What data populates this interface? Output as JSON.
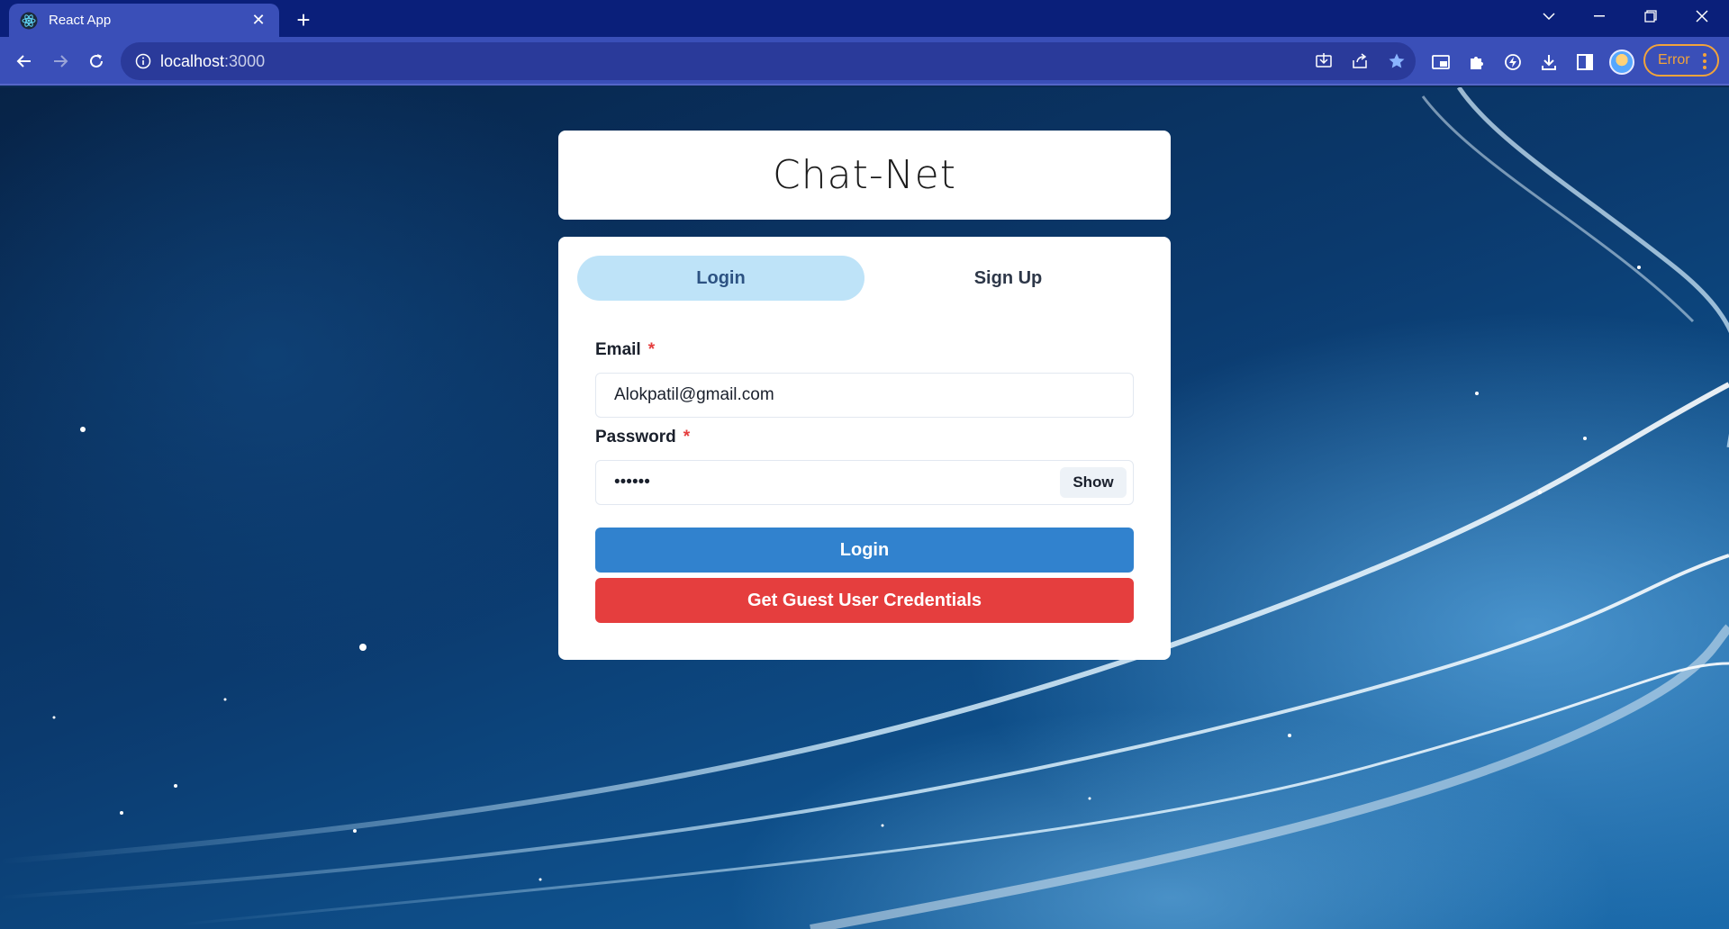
{
  "browser": {
    "tab_title": "React App",
    "url_host": "localhost",
    "url_port": ":3000",
    "profile_status": "Error",
    "icons": {
      "favicon": "react-logo-icon",
      "tab_close": "close-icon",
      "new_tab": "plus-icon",
      "back": "back-arrow-icon",
      "forward": "forward-arrow-icon",
      "reload": "reload-icon",
      "site_info": "info-icon",
      "install": "install-icon",
      "share": "share-icon",
      "bookmark": "star-icon",
      "media": "media-icon",
      "extensions": "puzzle-icon",
      "performance": "performance-icon",
      "downloads": "download-icon",
      "side_panel": "side-panel-icon",
      "menu": "kebab-menu-icon"
    },
    "accent_colors": {
      "tabstrip": "#0a1f7a",
      "toolbar": "#3a4fb8",
      "error": "#f2a33a"
    }
  },
  "app": {
    "title": "Chat-Net",
    "tabs": [
      {
        "label": "Login",
        "active": true
      },
      {
        "label": "Sign Up",
        "active": false
      }
    ],
    "form": {
      "email_label": "Email",
      "email_value": "Alokpatil@gmail.com",
      "password_label": "Password",
      "password_value": "••••••",
      "required_mark": "*",
      "show_label": "Show",
      "login_label": "Login",
      "guest_label": "Get Guest User Credentials"
    },
    "colors": {
      "login_button": "#3182ce",
      "guest_button": "#e53e3e",
      "active_tab": "#bee3f8"
    }
  }
}
